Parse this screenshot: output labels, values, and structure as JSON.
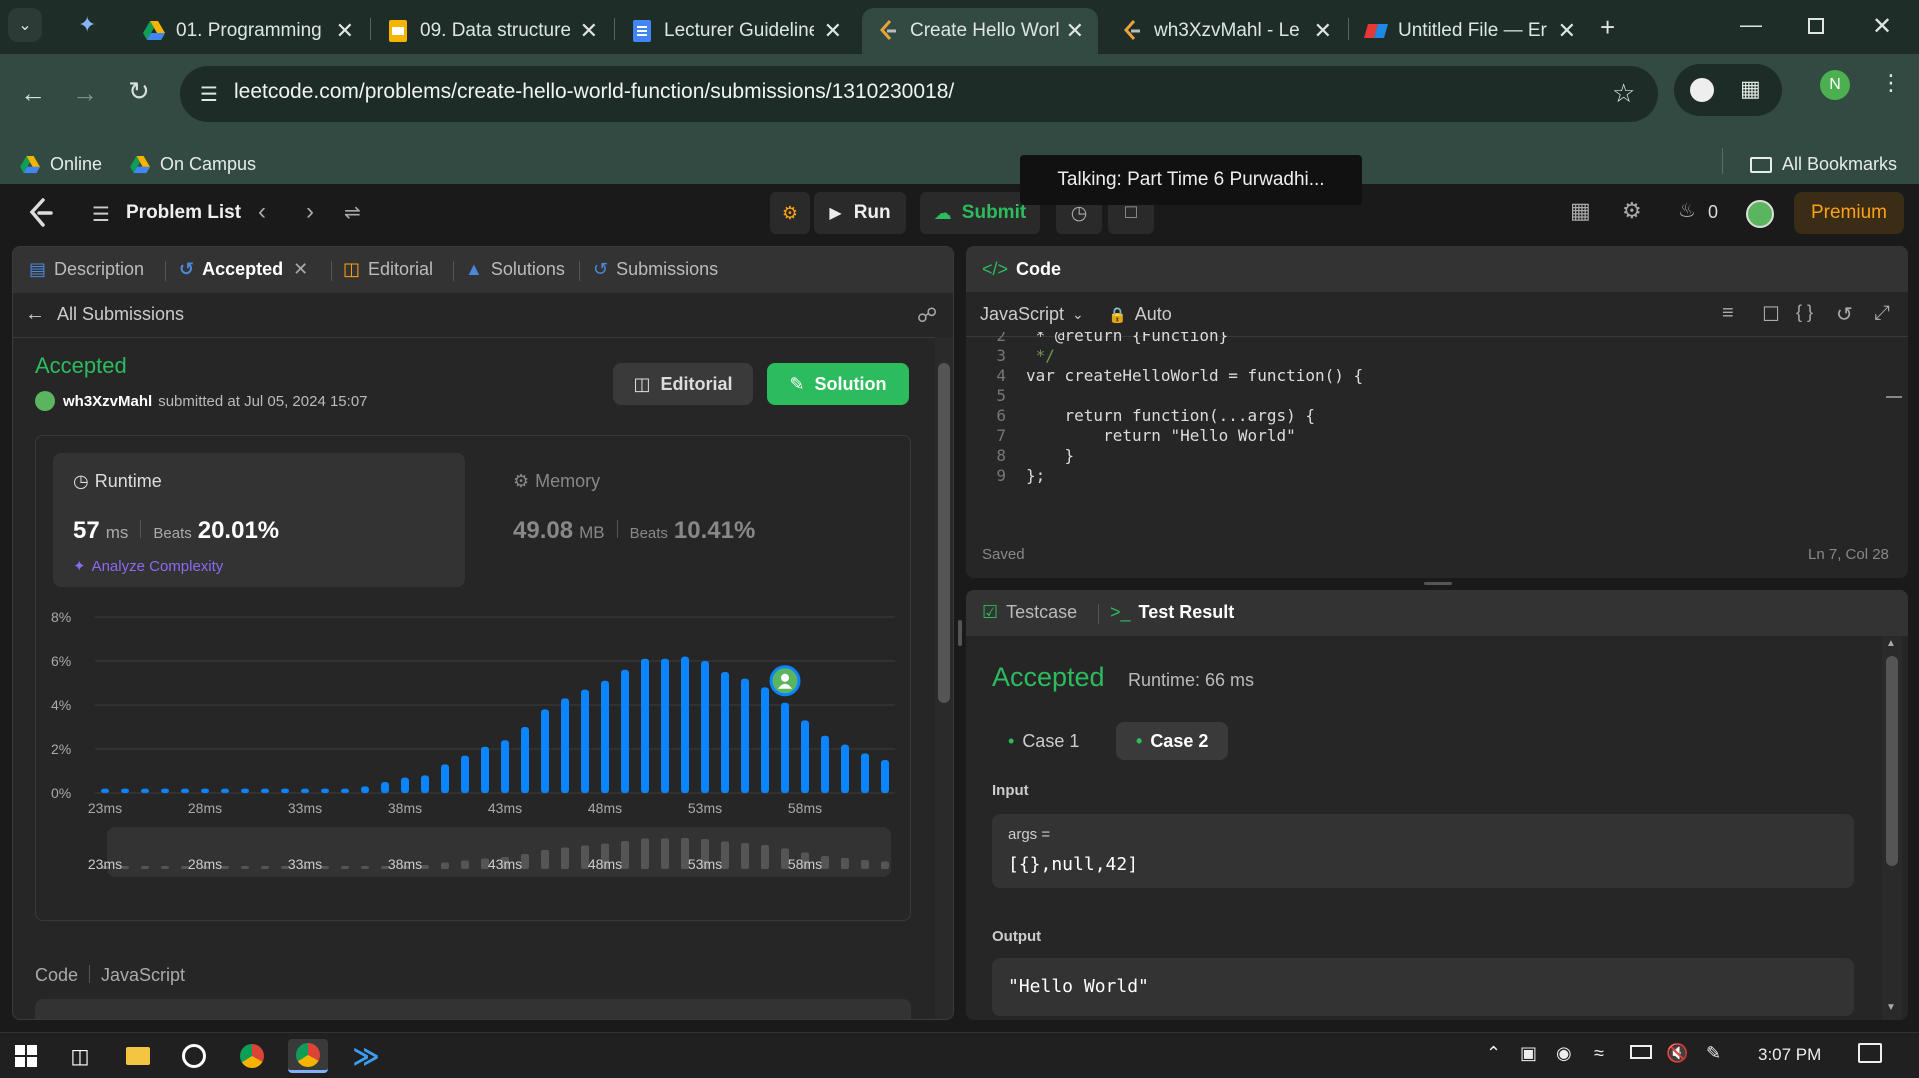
{
  "browser": {
    "tabs": [
      {
        "title": "01. Programming",
        "icon": "google-drive-icon"
      },
      {
        "title": "09. Data structure",
        "icon": "google-slides-icon"
      },
      {
        "title": "Lecturer Guideline",
        "icon": "google-docs-icon"
      },
      {
        "title": "Create Hello World",
        "icon": "leetcode-icon",
        "active": true
      },
      {
        "title": "wh3XzvMahl - Le",
        "icon": "leetcode-icon"
      },
      {
        "title": "Untitled File — Er",
        "icon": "eraser-icon"
      }
    ],
    "url": "leetcode.com/problems/create-hello-world-function/submissions/1310230018/",
    "profile_initial": "N",
    "bookmarks": [
      "Online",
      "On Campus"
    ],
    "all_bookmarks": "All Bookmarks",
    "tooltip": "Talking: Part Time 6 Purwadhi..."
  },
  "lc": {
    "problem_list": "Problem List",
    "run": "Run",
    "submit": "Submit",
    "streak": "0",
    "premium": "Premium",
    "colors": {
      "accent": "#2cbb5d",
      "orange": "#ffa116",
      "bar": "#0a84ff"
    }
  },
  "left": {
    "tabs": [
      "Description",
      "Accepted",
      "Editorial",
      "Solutions",
      "Submissions"
    ],
    "back_label": "All Submissions",
    "status": "Accepted",
    "user": "wh3XzvMahl",
    "submitted": "submitted at Jul 05, 2024 15:07",
    "editorial_btn": "Editorial",
    "solution_btn": "Solution",
    "runtime": {
      "label": "Runtime",
      "value": "57",
      "unit": "ms",
      "beats_label": "Beats",
      "beats": "20.01%",
      "analyze": "Analyze Complexity"
    },
    "memory": {
      "label": "Memory",
      "value": "49.08",
      "unit": "MB",
      "beats_label": "Beats",
      "beats": "10.41%"
    },
    "code_label": "Code",
    "code_lang": "JavaScript"
  },
  "chart_data": {
    "type": "bar",
    "ylabels": [
      "8%",
      "6%",
      "4%",
      "2%",
      "0%"
    ],
    "ylim": [
      0,
      8
    ],
    "xlabels": [
      "23ms",
      "28ms",
      "33ms",
      "38ms",
      "43ms",
      "48ms",
      "53ms",
      "58ms"
    ],
    "x": [
      23,
      24,
      25,
      26,
      27,
      28,
      29,
      30,
      31,
      32,
      33,
      34,
      35,
      36,
      37,
      38,
      39,
      40,
      41,
      42,
      43,
      44,
      45,
      46,
      47,
      48,
      49,
      50,
      51,
      52,
      53,
      54,
      55,
      56,
      57,
      58,
      59,
      60,
      61,
      62
    ],
    "values": [
      0.2,
      0.2,
      0.2,
      0.2,
      0.2,
      0.2,
      0.2,
      0.2,
      0.2,
      0.2,
      0.2,
      0.2,
      0.2,
      0.3,
      0.5,
      0.7,
      0.8,
      1.3,
      1.7,
      2.1,
      2.4,
      3.0,
      3.8,
      4.3,
      4.7,
      5.1,
      5.6,
      6.1,
      6.1,
      6.2,
      6.0,
      5.5,
      5.2,
      4.8,
      4.1,
      3.3,
      2.6,
      2.2,
      1.8,
      1.5
    ],
    "user_x": 57,
    "grid": true
  },
  "right": {
    "code_title": "Code",
    "language": "JavaScript",
    "mode": "Auto",
    "code_lines": [
      {
        "n": "2",
        "text": " * @return {Function}"
      },
      {
        "n": "3",
        "text": " */"
      },
      {
        "n": "4",
        "text": "var createHelloWorld = function() {"
      },
      {
        "n": "5",
        "text": ""
      },
      {
        "n": "6",
        "text": "    return function(...args) {"
      },
      {
        "n": "7",
        "text": "        return \"Hello World\""
      },
      {
        "n": "8",
        "text": "    }"
      },
      {
        "n": "9",
        "text": "};"
      }
    ],
    "saved": "Saved",
    "cursor": "Ln 7, Col 28",
    "testcase_tab": "Testcase",
    "result_tab": "Test Result",
    "result_status": "Accepted",
    "result_runtime": "Runtime: 66 ms",
    "cases": [
      "Case 1",
      "Case 2"
    ],
    "input_label": "Input",
    "input_var": "args =",
    "input_value": "[{},null,42]",
    "output_label": "Output",
    "output_value": "\"Hello World\""
  },
  "taskbar": {
    "time": "3:07 PM"
  }
}
